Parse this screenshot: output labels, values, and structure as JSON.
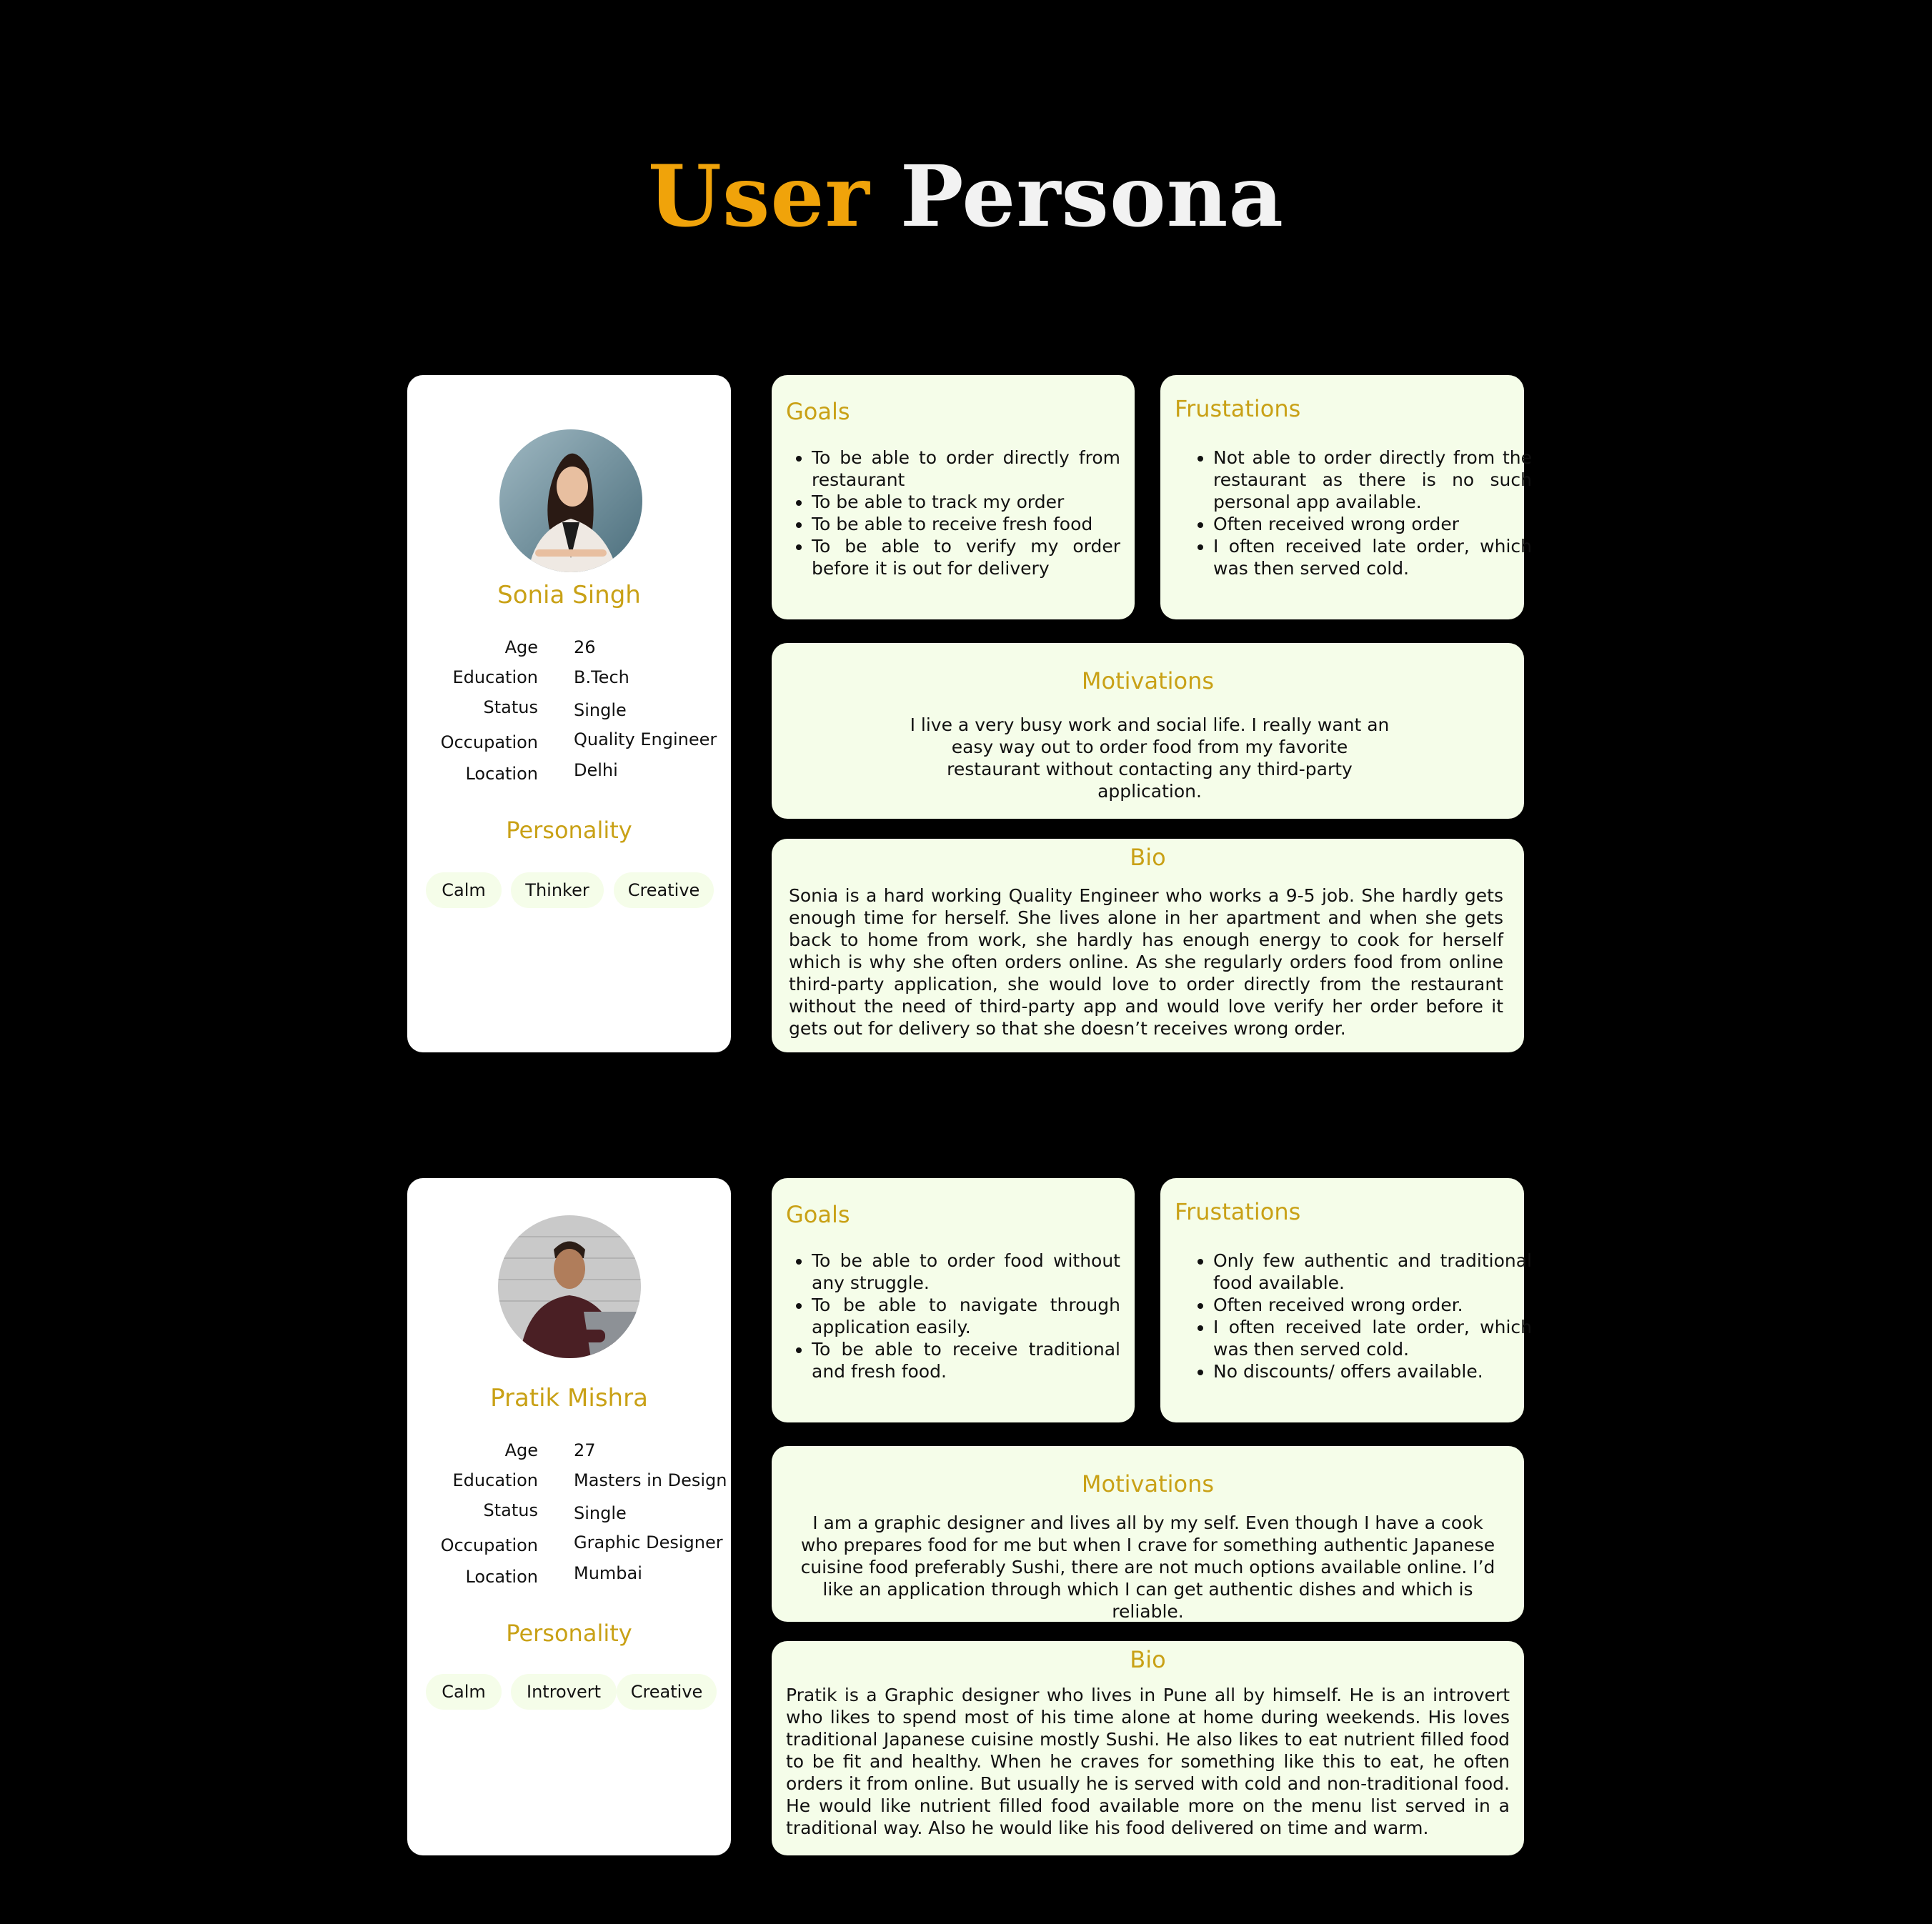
{
  "title": {
    "word1": "User",
    "word2": "Persona"
  },
  "personas": [
    {
      "name": "Sonia Singh",
      "attributes": [
        {
          "label": "Age",
          "value": "26"
        },
        {
          "label": "Education",
          "value": "B.Tech"
        },
        {
          "label": "Status",
          "value": "Single"
        },
        {
          "label": "Occupation",
          "value": "Quality Engineer"
        },
        {
          "label": "Location",
          "value": "Delhi"
        }
      ],
      "personality_title": "Personality",
      "personality": [
        "Calm",
        "Thinker",
        "Creative"
      ],
      "goals": {
        "title": "Goals",
        "items": [
          "To be able to order directly from restaurant",
          "To be able to track my order",
          "To be able to receive fresh food",
          "To be able to verify my order before it is out for delivery"
        ]
      },
      "frustrations": {
        "title": "Frustations",
        "items": [
          "Not able to order directly from the restaurant as there is no such personal app available.",
          "Often received wrong order",
          "I often received late order, which was then served cold."
        ]
      },
      "motivations": {
        "title": "Motivations",
        "text": "I live a very busy work and social life. I really want an easy way out to order food from my favorite restaurant without contacting any third-party application."
      },
      "bio": {
        "title": "Bio",
        "text": "Sonia is a hard working Quality Engineer who works a 9-5 job. She hardly gets enough time for herself. She lives alone in her apartment and when she gets back to home from work, she hardly has enough energy to cook for herself which is why she often orders online. As she regularly orders food from online third-party application, she would love to order directly from the restaurant without the need of third-party app and would love verify her order before it gets out for delivery so that she doesn’t receives wrong order."
      }
    },
    {
      "name": "Pratik Mishra",
      "attributes": [
        {
          "label": "Age",
          "value": "27"
        },
        {
          "label": "Education",
          "value": "Masters in Design"
        },
        {
          "label": "Status",
          "value": "Single"
        },
        {
          "label": "Occupation",
          "value": "Graphic Designer"
        },
        {
          "label": "Location",
          "value": "Mumbai"
        }
      ],
      "personality_title": "Personality",
      "personality": [
        "Calm",
        "Introvert",
        "Creative"
      ],
      "goals": {
        "title": "Goals",
        "items": [
          "To be able to order food without any struggle.",
          "To be able to navigate through application easily.",
          "To be able to receive traditional and fresh food."
        ]
      },
      "frustrations": {
        "title": "Frustations",
        "items": [
          "Only few authentic and traditional food available.",
          "Often received wrong order.",
          "I often received late order, which was then served cold.",
          "No discounts/ offers available."
        ]
      },
      "motivations": {
        "title": "Motivations",
        "text": "I am a graphic designer and lives all by my self. Even though I have a cook who prepares food for me but when I crave for something authentic Japanese cuisine food preferably Sushi, there are not much options available online. I’d like an application through which I can get authentic dishes and which is reliable."
      },
      "bio": {
        "title": "Bio",
        "text": "Pratik is a Graphic designer who lives in Pune all by himself. He is an introvert who likes to spend most of his time alone at home during weekends. His loves traditional Japanese cuisine mostly Sushi. He also likes to eat nutrient filled food to be fit and healthy. When he craves for something like this to eat, he often orders it from online. But usually he is served with cold and non-traditional food. He would like nutrient filled food available more on the menu list served in a traditional way. Also he would like his food delivered on time and warm."
      }
    }
  ]
}
